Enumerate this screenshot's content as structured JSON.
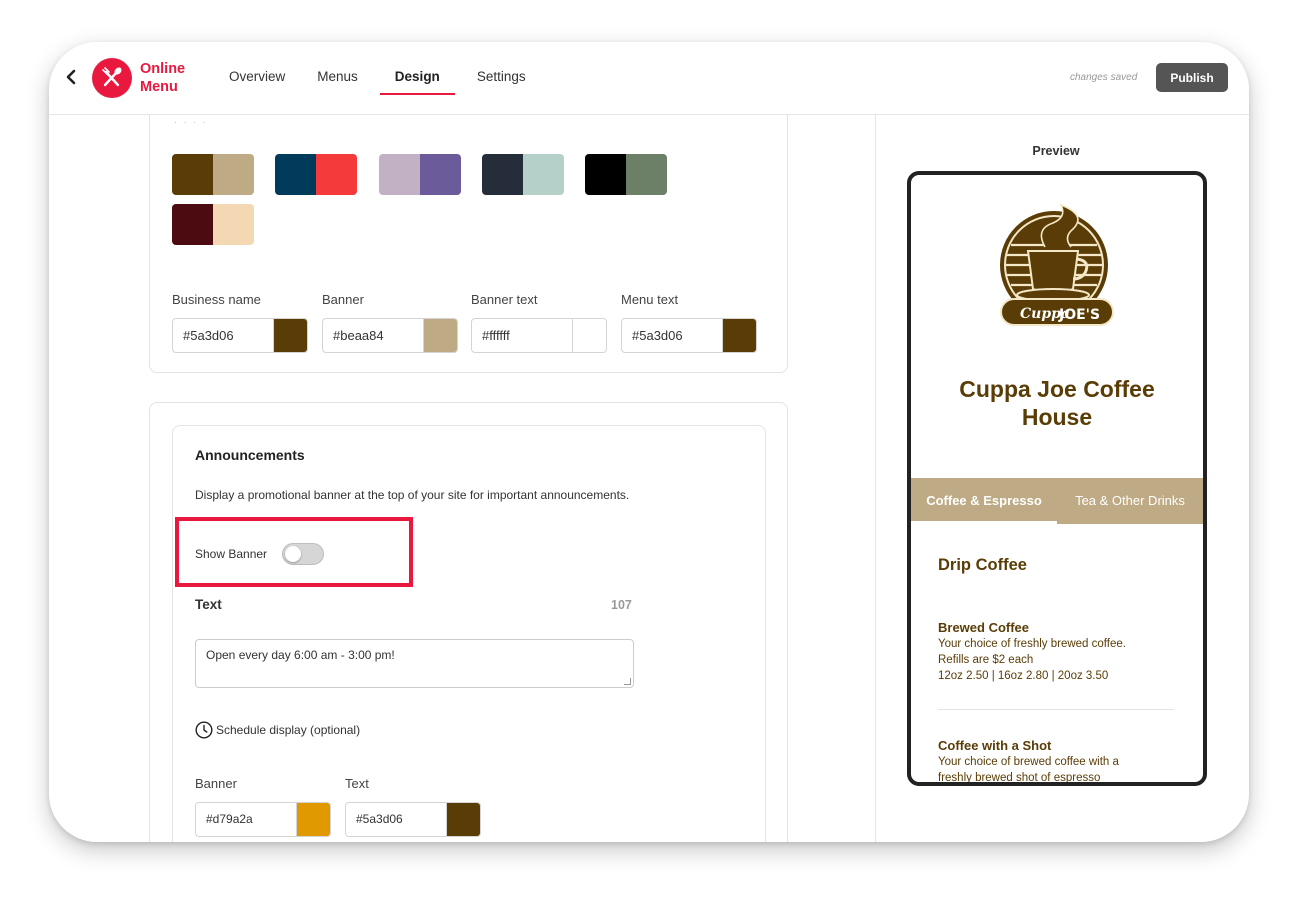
{
  "header": {
    "app_name": "Online Menu",
    "nav": [
      {
        "label": "Overview",
        "active": false
      },
      {
        "label": "Menus",
        "active": false
      },
      {
        "label": "Design",
        "active": true
      },
      {
        "label": "Settings",
        "active": false
      }
    ],
    "status": "changes saved",
    "publish_label": "Publish"
  },
  "colors": {
    "brand": "#e8183e",
    "palettes": [
      {
        "left": "#5a3d06",
        "right": "#beaa84"
      },
      {
        "left": "#003b5c",
        "right": "#f43a3a"
      },
      {
        "left": "#c2b0c4",
        "right": "#6b5b9a"
      },
      {
        "left": "#262d3a",
        "right": "#b4d0c8"
      },
      {
        "left": "#000000",
        "right": "#6b8066"
      },
      {
        "left": "#4c0a11",
        "right": "#f4d8b4"
      }
    ],
    "fields": [
      {
        "label": "Business name",
        "value": "#5a3d06",
        "chip": "#5a3d06"
      },
      {
        "label": "Banner",
        "value": "#beaa84",
        "chip": "#beaa84"
      },
      {
        "label": "Banner text",
        "value": "#ffffff",
        "chip": "#ffffff"
      },
      {
        "label": "Menu text",
        "value": "#5a3d06",
        "chip": "#5a3d06"
      }
    ]
  },
  "announcements": {
    "title": "Announcements",
    "description": "Display a promotional banner at the top of your site for important announcements.",
    "show_banner_label": "Show Banner",
    "show_banner_on": false,
    "text_label": "Text",
    "char_count": "107",
    "text_value": "Open every day 6:00 am - 3:00 pm!",
    "schedule_label": "Schedule display (optional)",
    "banner_label": "Banner",
    "banner_value": "#d79a2a",
    "banner_chip": "#e09a00",
    "text_color_label": "Text",
    "text_color_value": "#5a3d06",
    "text_color_chip": "#5a3d06"
  },
  "preview": {
    "title": "Preview",
    "logo_text_1": "Cuppa",
    "logo_text_2": "JOE'S",
    "business_name": "Cuppa Joe Coffee House",
    "tabs": [
      {
        "label": "Coffee & Espresso",
        "active": true
      },
      {
        "label": "Tea & Other Drinks",
        "active": false
      }
    ],
    "section": "Drip Coffee",
    "items": [
      {
        "name": "Brewed Coffee",
        "desc_1": "Your choice of freshly brewed coffee.",
        "desc_2": "Refills are $2 each",
        "desc_3": "12oz 2.50 | 16oz 2.80 | 20oz 3.50"
      },
      {
        "name": "Coffee with a Shot",
        "desc_1": "Your choice of brewed coffee with a",
        "desc_2": "freshly brewed shot of espresso"
      }
    ]
  }
}
